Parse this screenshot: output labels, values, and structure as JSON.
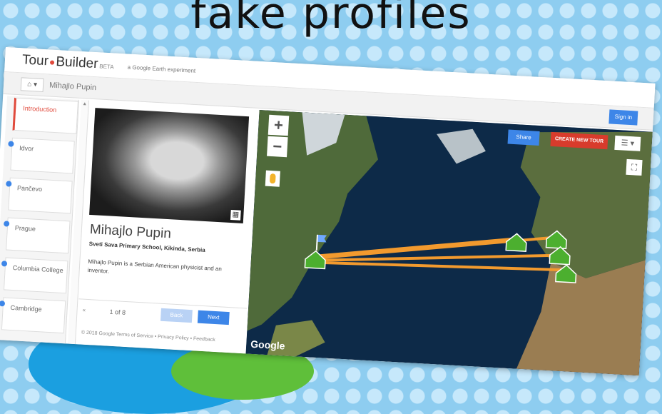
{
  "slide": {
    "title": "fake profiles"
  },
  "app": {
    "logo_prefix": "Tour",
    "logo_suffix": "Builder",
    "logo_badge": "BETA",
    "tagline": "a Google Earth experiment",
    "breadcrumb": "Mihajlo Pupin",
    "sign_in": "Sign in"
  },
  "sidebar": {
    "items": [
      {
        "label": "Introduction",
        "active": true
      },
      {
        "label": "Idvor"
      },
      {
        "label": "Pančevo"
      },
      {
        "label": "Prague"
      },
      {
        "label": "Columbia College"
      },
      {
        "label": "Cambridge"
      }
    ]
  },
  "profile": {
    "name": "Mihajlo Pupin",
    "subtitle": "Sveti Sava Primary School, Kikinda, Serbia",
    "description": "Mihajlo Pupin is a Serbian American physicist and an inventor.",
    "page": "1 of 8",
    "prev": "«",
    "back": "Back",
    "next": "Next",
    "legal": "© 2018 Google  Terms of Service • Privacy Policy • Feedback"
  },
  "map": {
    "share": "Share",
    "create": "CREATE NEW TOUR",
    "zoom_in": "+",
    "zoom_out": "−",
    "watermark": "Google",
    "colors": {
      "route": "#f29a2e",
      "marker": "#4caf2f",
      "ocean": "#0d2a48"
    }
  }
}
